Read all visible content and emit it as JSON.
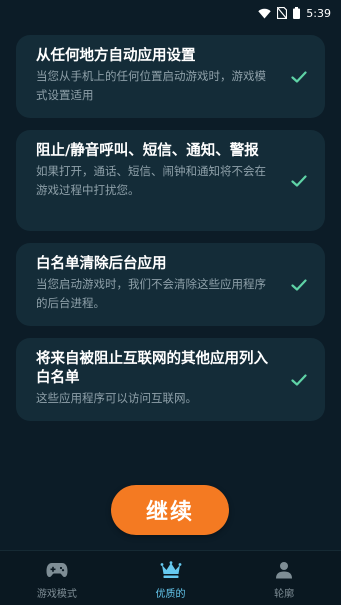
{
  "status_bar": {
    "time": "5:39"
  },
  "cards": [
    {
      "title": "从任何地方自动应用设置",
      "desc": "当您从手机上的任何位置启动游戏时，游戏模式设置适用"
    },
    {
      "title": "阻止/静音呼叫、短信、通知、警报",
      "desc": "如果打开，通话、短信、闹钟和通知将不会在游戏过程中打扰您。"
    },
    {
      "title": "白名单清除后台应用",
      "desc": "当您启动游戏时，我们不会清除这些应用程序的后台进程。"
    },
    {
      "title": "将来自被阻止互联网的其他应用列入白名单",
      "desc": "这些应用程序可以访问互联网。"
    }
  ],
  "continue_label": "继续",
  "nav": {
    "items": [
      {
        "label": "游戏模式",
        "icon": "gamepad-icon"
      },
      {
        "label": "优质的",
        "icon": "crown-icon"
      },
      {
        "label": "轮廓",
        "icon": "profile-icon"
      }
    ],
    "active_index": 1
  },
  "colors": {
    "background": "#0c1c27",
    "card": "#142c38",
    "check": "#5fd3a6",
    "accent_button": "#f47a22",
    "active_nav": "#66c9f0"
  }
}
